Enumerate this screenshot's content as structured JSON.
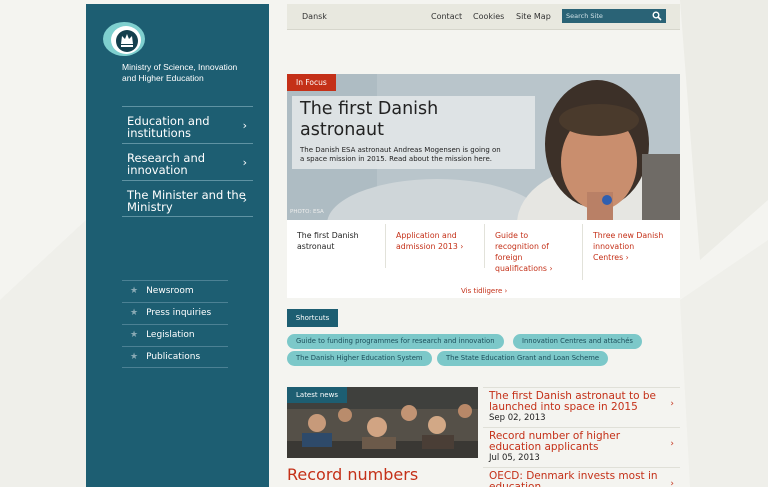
{
  "colors": {
    "sidebar": "#1d5e72",
    "accent_red": "#c43018",
    "pill": "#7cc8c9",
    "page_bg": "#f4f4f0"
  },
  "sidebar": {
    "org_name_line1": "Ministry of Science, Innovation",
    "org_name_line2": "and Higher Education",
    "main_nav": [
      {
        "line1": "Education and",
        "line2": "institutions",
        "icon": "chevron-right-icon"
      },
      {
        "line1": "Research and",
        "line2": "innovation",
        "icon": "chevron-right-icon"
      },
      {
        "line1": "The Minister and the",
        "line2": "Ministry",
        "icon": "chevron-right-icon"
      }
    ],
    "sub_nav": [
      {
        "label": "Newsroom",
        "icon": "star-icon"
      },
      {
        "label": "Press inquiries",
        "icon": "star-icon"
      },
      {
        "label": "Legislation",
        "icon": "star-icon"
      },
      {
        "label": "Publications",
        "icon": "star-icon"
      }
    ]
  },
  "topbar": {
    "language": "Dansk",
    "contact": "Contact",
    "cookies": "Cookies",
    "sitemap": "Site Map",
    "search_placeholder": "Search Site"
  },
  "focus": {
    "label": "In Focus",
    "title_line1": "The first Danish",
    "title_line2": "astronaut",
    "text_line1": "The Danish ESA astronaut Andreas Mogensen is going on",
    "text_line2": "a space mission in 2015. Read about the mission here.",
    "photo_credit": "PHOTO: ESA",
    "tabs": [
      {
        "line1": "The first Danish",
        "line2": "astronaut",
        "line3": "",
        "line4": ""
      },
      {
        "line1": "Application and",
        "line2": "admission 2013 ›",
        "line3": "",
        "line4": ""
      },
      {
        "line1": "Guide to",
        "line2": "recognition of",
        "line3": "foreign",
        "line4": "qualifications ›"
      },
      {
        "line1": "Three new Danish",
        "line2": "innovation",
        "line3": "Centres ›",
        "line4": ""
      }
    ],
    "see_more": "Vis tidligere ›"
  },
  "shortcuts": {
    "label": "Shortcuts",
    "items": [
      "Guide to funding programmes for research and innovation",
      "Innovation Centres and attachés",
      "The Danish Higher Education System",
      "The State Education Grant and Loan Scheme"
    ]
  },
  "news": {
    "label": "Latest news",
    "headline": "Record numbers",
    "items": [
      {
        "title": "The first Danish astronaut to be launched into space in 2015",
        "date": "Sep 02, 2013"
      },
      {
        "title": "Record number of higher education applicants",
        "date": "Jul 05, 2013"
      },
      {
        "title": "OECD: Denmark invests most in education",
        "date": ""
      }
    ]
  }
}
